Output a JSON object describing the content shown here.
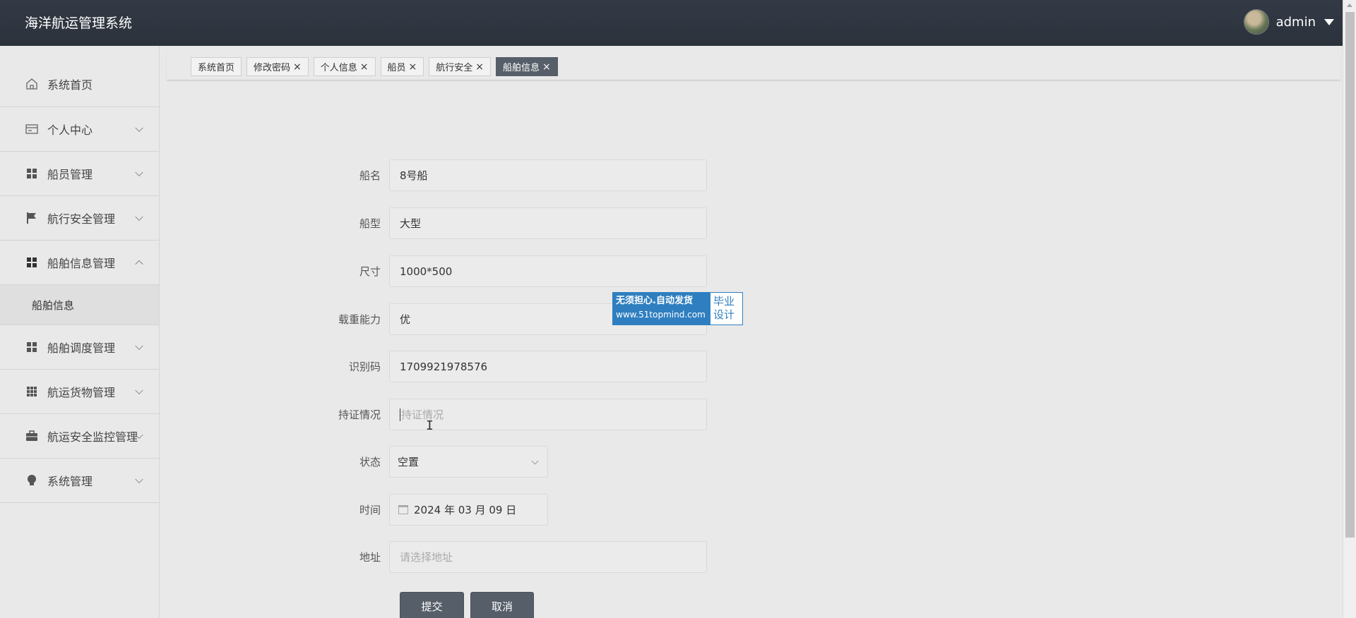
{
  "header": {
    "title": "海洋航运管理系统",
    "username": "admin"
  },
  "sidebar": {
    "items": [
      {
        "label": "系统首页",
        "icon": "home-icon"
      },
      {
        "label": "个人中心",
        "icon": "card-icon"
      },
      {
        "label": "船员管理",
        "icon": "grid-icon"
      },
      {
        "label": "航行安全管理",
        "icon": "flag-icon"
      },
      {
        "label": "船舶信息管理",
        "icon": "grid-icon",
        "expanded": true
      },
      {
        "label": "船舶调度管理",
        "icon": "grid-icon"
      },
      {
        "label": "航运货物管理",
        "icon": "apps-icon"
      },
      {
        "label": "航运安全监控管理",
        "icon": "briefcase-icon"
      },
      {
        "label": "系统管理",
        "icon": "bulb-icon"
      }
    ],
    "sub_items": [
      "船舶信息"
    ]
  },
  "tabs": [
    {
      "label": "系统首页",
      "closable": false
    },
    {
      "label": "修改密码",
      "closable": true
    },
    {
      "label": "个人信息",
      "closable": true
    },
    {
      "label": "船员",
      "closable": true
    },
    {
      "label": "航行安全",
      "closable": true
    },
    {
      "label": "船舶信息",
      "closable": true,
      "active": true
    }
  ],
  "form": {
    "ship_name": {
      "label": "船名",
      "value": "8号船"
    },
    "ship_type": {
      "label": "船型",
      "value": "大型"
    },
    "size": {
      "label": "尺寸",
      "value": "1000*500"
    },
    "capacity": {
      "label": "载重能力",
      "value": "优"
    },
    "code": {
      "label": "识别码",
      "value": "1709921978576"
    },
    "license": {
      "label": "持证情况",
      "placeholder": "持证情况"
    },
    "status": {
      "label": "状态",
      "value": "空置"
    },
    "time": {
      "label": "时间",
      "value": "2024 年 03 月 09 日"
    },
    "address": {
      "label": "地址",
      "placeholder": "请选择地址"
    },
    "submit_label": "提交",
    "cancel_label": "取消"
  },
  "badge": {
    "line1": "无须担心.自动发货",
    "line2": "www.51topmind.com",
    "right1": "毕业",
    "right2": "设计"
  },
  "colors": {
    "header_bg": "#333a45",
    "active_tab": "#565e69",
    "badge_blue": "#2f7fc0"
  }
}
